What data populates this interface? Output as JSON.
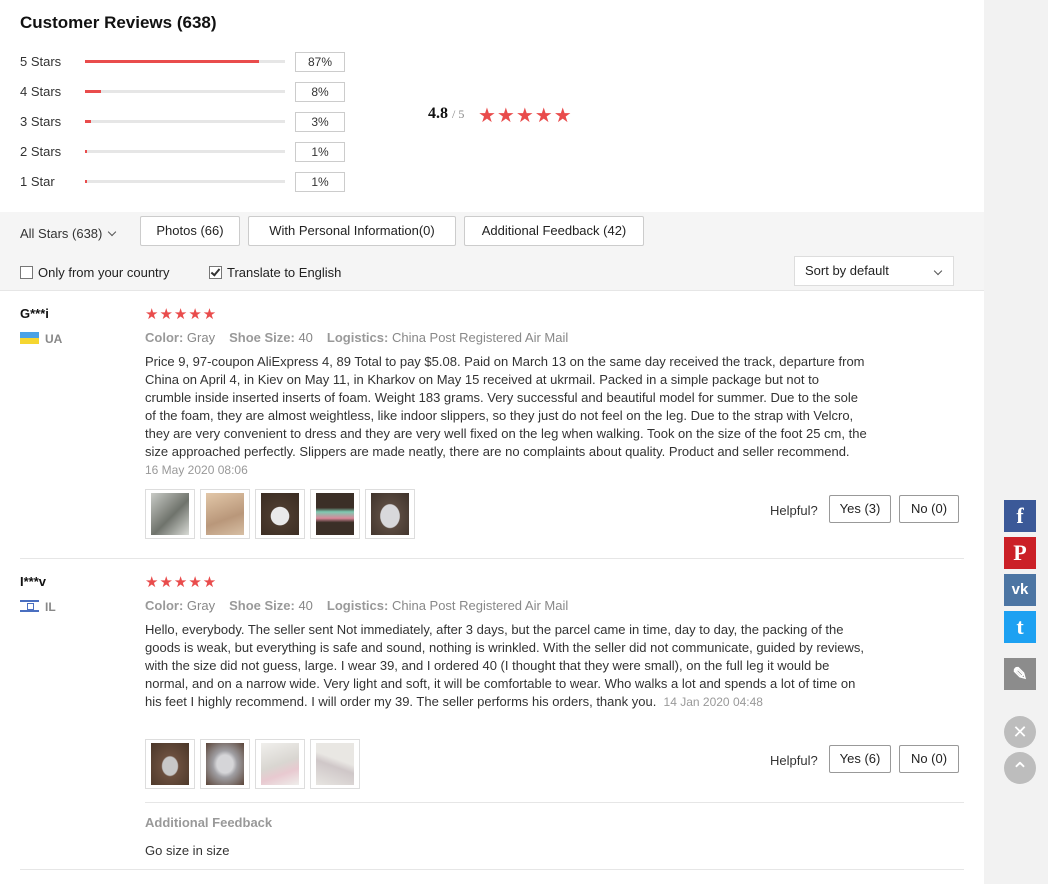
{
  "header": {
    "title": "Customer Reviews (638)"
  },
  "rating_breakdown": [
    {
      "label": "5 Stars",
      "percent": "87%",
      "fraction": 0.87
    },
    {
      "label": "4 Stars",
      "percent": "8%",
      "fraction": 0.08
    },
    {
      "label": "3 Stars",
      "percent": "3%",
      "fraction": 0.03
    },
    {
      "label": "2 Stars",
      "percent": "1%",
      "fraction": 0.01
    },
    {
      "label": "1 Star",
      "percent": "1%",
      "fraction": 0.01
    }
  ],
  "average": {
    "value": "4.8",
    "out_of": "/ 5",
    "stars": "★★★★★"
  },
  "filters": {
    "all_stars": "All Stars (638)",
    "photos": "Photos (66)",
    "personal_info": "With Personal Information(0)",
    "additional_feedback": "Additional Feedback (42)",
    "only_country": "Only from your country",
    "only_country_checked": false,
    "translate": "Translate to English",
    "translate_checked": true,
    "sort": "Sort by default"
  },
  "reviews": [
    {
      "user": "G***i",
      "country": "UA",
      "stars": "★★★★★",
      "color_label": "Color:",
      "color": "Gray",
      "size_label": "Shoe Size:",
      "size": "40",
      "logistics_label": "Logistics:",
      "logistics": "China Post Registered Air Mail",
      "text": "Price 9, 97-coupon AliExpress 4, 89 Total to pay $5.08. Paid on March 13 on the same day received the track, departure from China on April 4, in Kiev on May 11, in Kharkov on May 15 received at ukrmail. Packed in a simple package but not to crumble inside inserted inserts of foam. Weight 183 grams. Very successful and beautiful model for summer. Due to the sole of the foam, they are almost weightless, like indoor slippers, so they just do not feel on the leg. Due to the strap with Velcro, they are very convenient to dress and they are very well fixed on the leg when walking. Took on the size of the foot 25 cm, the size approached perfectly. Slippers are made neatly, there are no complaints about quality. Product and seller recommend.",
      "date": "16 May 2020 08:06",
      "helpful_label": "Helpful?",
      "yes": "Yes (3)",
      "no": "No (0)"
    },
    {
      "user": "I***v",
      "country": "IL",
      "stars": "★★★★★",
      "color_label": "Color:",
      "color": "Gray",
      "size_label": "Shoe Size:",
      "size": "40",
      "logistics_label": "Logistics:",
      "logistics": "China Post Registered Air Mail",
      "text": "Hello, everybody. The seller sent Not immediately, after 3 days, but the parcel came in time, day to day, the packing of the goods is weak, but everything is safe and sound, nothing is wrinkled. With the seller did not communicate, guided by reviews, with the size did not guess, large. I wear 39, and I ordered 40 (I thought that they were small), on the full leg it would be normal, and on a narrow wide. Very light and soft, it will be comfortable to wear. Who walks a lot and spends a lot of time on his feet I highly recommend. I will order my 39. The seller performs his orders, thank you.",
      "date": "14 Jan 2020 04:48",
      "helpful_label": "Helpful?",
      "yes": "Yes (6)",
      "no": "No (0)",
      "additional_feedback_title": "Additional Feedback",
      "additional_feedback_text": "Go size in size"
    }
  ],
  "social": {
    "facebook": "f",
    "pinterest": "P",
    "vk": "vk",
    "twitter": "t",
    "edit": "✎",
    "close": "✕",
    "top": "⌃"
  }
}
